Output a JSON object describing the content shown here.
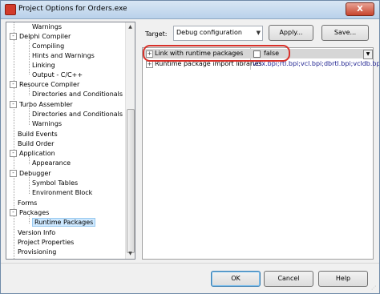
{
  "window": {
    "title": "Project Options for Orders.exe",
    "close_glyph": "X"
  },
  "tree": {
    "items": [
      {
        "label": "Warnings"
      },
      {
        "label": "Delphi Compiler",
        "expander": "-"
      },
      {
        "label": "Compiling"
      },
      {
        "label": "Hints and Warnings"
      },
      {
        "label": "Linking"
      },
      {
        "label": "Output - C/C++"
      },
      {
        "label": "Resource Compiler",
        "expander": "-"
      },
      {
        "label": "Directories and Conditionals"
      },
      {
        "label": "Turbo Assembler",
        "expander": "-"
      },
      {
        "label": "Directories and Conditionals"
      },
      {
        "label": "Warnings"
      },
      {
        "label": "Build Events"
      },
      {
        "label": "Build Order"
      },
      {
        "label": "Application",
        "expander": "-"
      },
      {
        "label": "Appearance"
      },
      {
        "label": "Debugger",
        "expander": "-"
      },
      {
        "label": "Symbol Tables"
      },
      {
        "label": "Environment Block"
      },
      {
        "label": "Forms"
      },
      {
        "label": "Packages",
        "expander": "-"
      },
      {
        "label": "Runtime Packages",
        "selected": true
      },
      {
        "label": "Version Info"
      },
      {
        "label": "Project Properties"
      },
      {
        "label": "Provisioning"
      }
    ],
    "scroll_up": "▲",
    "scroll_down": "▼"
  },
  "target": {
    "label": "Target:",
    "value": "Debug configuration",
    "arrow": "▼"
  },
  "buttons": {
    "apply": "Apply...",
    "save": "Save...",
    "ok": "OK",
    "cancel": "Cancel",
    "help": "Help"
  },
  "properties": {
    "rows": [
      {
        "expander": "+",
        "name": "Link with runtime packages",
        "value": "false",
        "dropdown": "▼"
      },
      {
        "expander": "+",
        "name": "Runtime package import libraries",
        "value": "vclx.bpi;rtl.bpi;vcl.bpi;dbrtl.bpi;vcldb.bpi"
      }
    ]
  },
  "colors": {
    "highlight_oval": "#d8312a",
    "selection": "#cde8ff",
    "value_text": "#1b1f8f"
  }
}
